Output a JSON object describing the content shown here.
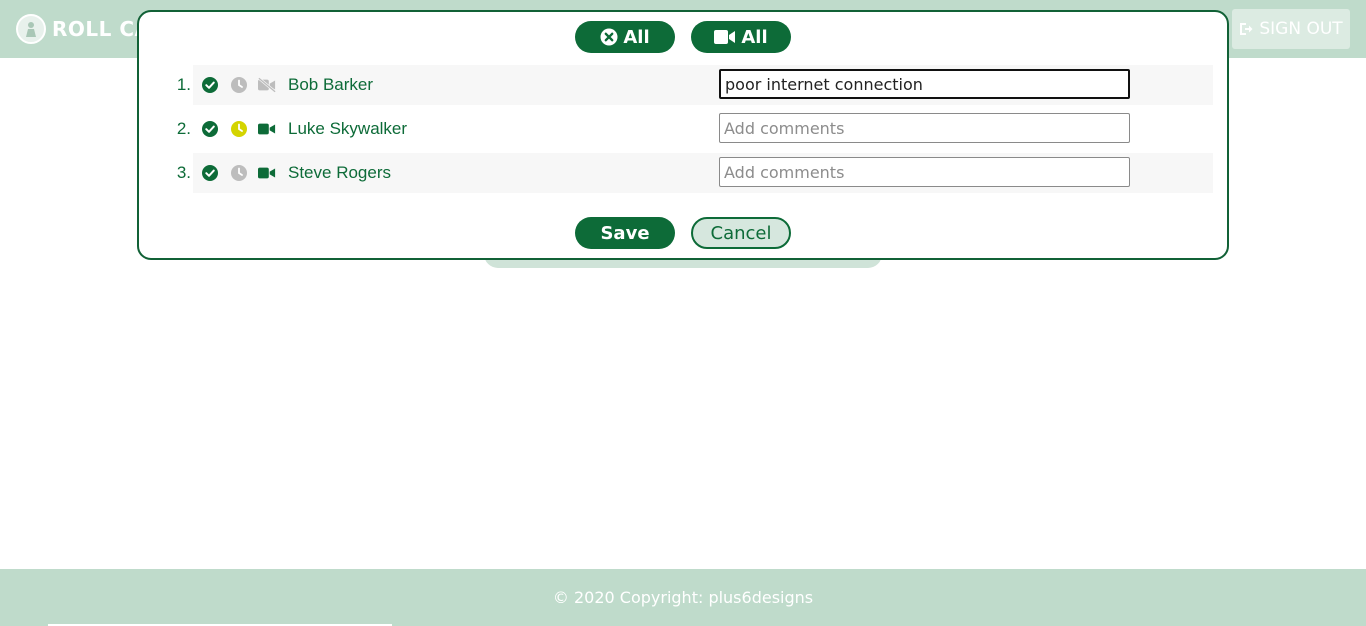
{
  "app": {
    "brand": "ROLL CA",
    "sign_out_label": "SIGN OUT"
  },
  "modal": {
    "all_absent_label": "All",
    "all_video_label": "All",
    "save_label": "Save",
    "cancel_label": "Cancel",
    "comment_placeholder": "Add comments",
    "rows": [
      {
        "number": "1.",
        "name": "Bob Barker",
        "comment": "poor internet connection",
        "clock_color": "#bdbdbd",
        "video_on": false
      },
      {
        "number": "2.",
        "name": "Luke Skywalker",
        "comment": "",
        "clock_color": "#d4d400",
        "video_on": true
      },
      {
        "number": "3.",
        "name": "Steve Rogers",
        "comment": "",
        "clock_color": "#bdbdbd",
        "video_on": true
      }
    ]
  },
  "footer": {
    "copyright": "© 2020 Copyright: plus6designs"
  },
  "colors": {
    "primary": "#0d6b38",
    "header_bg": "#bfdbcb",
    "late_yellow": "#d4d400",
    "muted_gray": "#bdbdbd"
  }
}
